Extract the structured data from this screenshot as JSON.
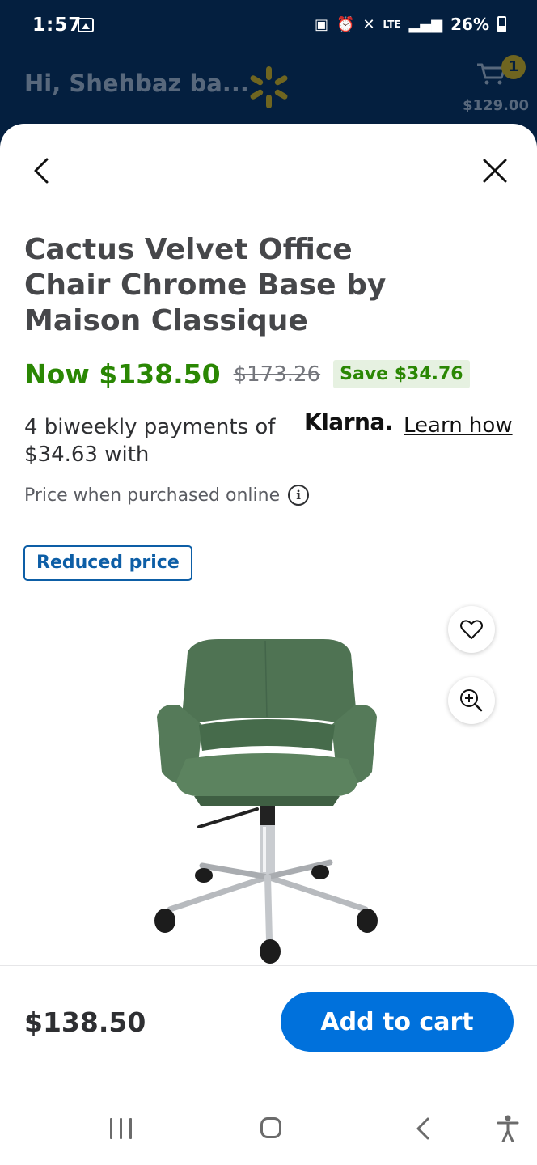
{
  "status_bar": {
    "time": "1:57",
    "network": "LTE",
    "battery": "26%"
  },
  "header": {
    "greeting": "Hi, Shehbaz ba...",
    "cart_count": "1",
    "cart_total": "$129.00"
  },
  "product": {
    "title": "Cactus Velvet Office Chair Chrome Base by Maison Classique",
    "now_price": "Now $138.50",
    "was_price": "$173.26",
    "save_badge": "Save $34.76",
    "klarna_text": "4 biweekly payments of $34.63 with",
    "klarna_logo": "Klarna.",
    "learn_how": "Learn how",
    "price_note": "Price when purchased online",
    "reduced_badge": "Reduced price",
    "image_icon": "office-chair"
  },
  "bottom_bar": {
    "price": "$138.50",
    "add_to_cart_label": "Add to cart"
  },
  "colors": {
    "header_bg": "#041f3f",
    "save_green": "#2a8703",
    "primary_blue": "#0071dc",
    "badge_blue": "#0d5ea6"
  },
  "icons": {
    "back": "chevron-left-icon",
    "close": "close-icon",
    "favorite": "heart-icon",
    "zoom": "zoom-in-icon",
    "cart": "cart-icon",
    "info": "info-icon"
  }
}
